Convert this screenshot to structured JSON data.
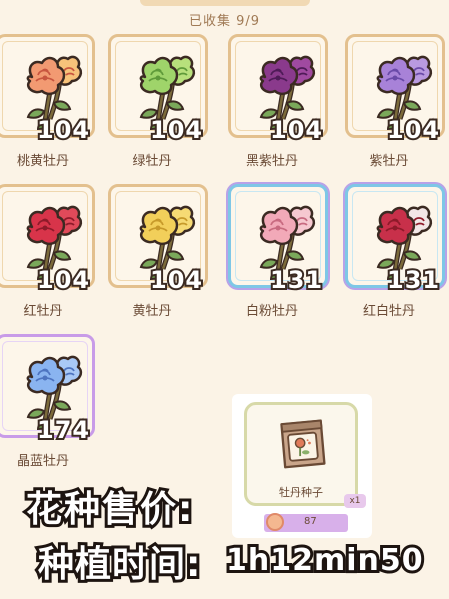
{
  "header": {
    "collected_label": "已收集 9/9"
  },
  "flowers": [
    {
      "name": "桃黄牡丹",
      "count": "104",
      "rarity": "normal",
      "petal": "#f29a72",
      "petal2": "#f7c27a",
      "petal_dark": "#c8553f"
    },
    {
      "name": "绿牡丹",
      "count": "104",
      "rarity": "normal",
      "petal": "#9fd46a",
      "petal2": "#b8e07c",
      "petal_dark": "#5f9a3a"
    },
    {
      "name": "黑紫牡丹",
      "count": "104",
      "rarity": "normal",
      "petal": "#8a3a8c",
      "petal2": "#a04aa0",
      "petal_dark": "#4e1b57"
    },
    {
      "name": "紫牡丹",
      "count": "104",
      "rarity": "normal",
      "petal": "#a882d8",
      "petal2": "#b99ae0",
      "petal_dark": "#6a4aa8"
    },
    {
      "name": "红牡丹",
      "count": "104",
      "rarity": "normal",
      "petal": "#d8344a",
      "petal2": "#e04a5a",
      "petal_dark": "#8e1a2a"
    },
    {
      "name": "黄牡丹",
      "count": "104",
      "rarity": "normal",
      "petal": "#f2cf5a",
      "petal2": "#f6da74",
      "petal_dark": "#c79a2a"
    },
    {
      "name": "白粉牡丹",
      "count": "131",
      "rarity": "rare",
      "petal": "#f2a9b8",
      "petal2": "#f6c8d0",
      "petal_dark": "#c86a80"
    },
    {
      "name": "红白牡丹",
      "count": "131",
      "rarity": "rare",
      "petal": "#c8304a",
      "petal2": "#f2e6e6",
      "petal_dark": "#8e1a2a"
    },
    {
      "name": "晶蓝牡丹",
      "count": "174",
      "rarity": "epic",
      "petal": "#8ab4f0",
      "petal2": "#a9c9f6",
      "petal_dark": "#4e74c0"
    }
  ],
  "seed": {
    "name": "牡丹种子",
    "quantity": "x1",
    "price": "87"
  },
  "captions": {
    "line1": "花种售价:",
    "line2": "种植时间:",
    "line2_value": "1h12min50"
  }
}
